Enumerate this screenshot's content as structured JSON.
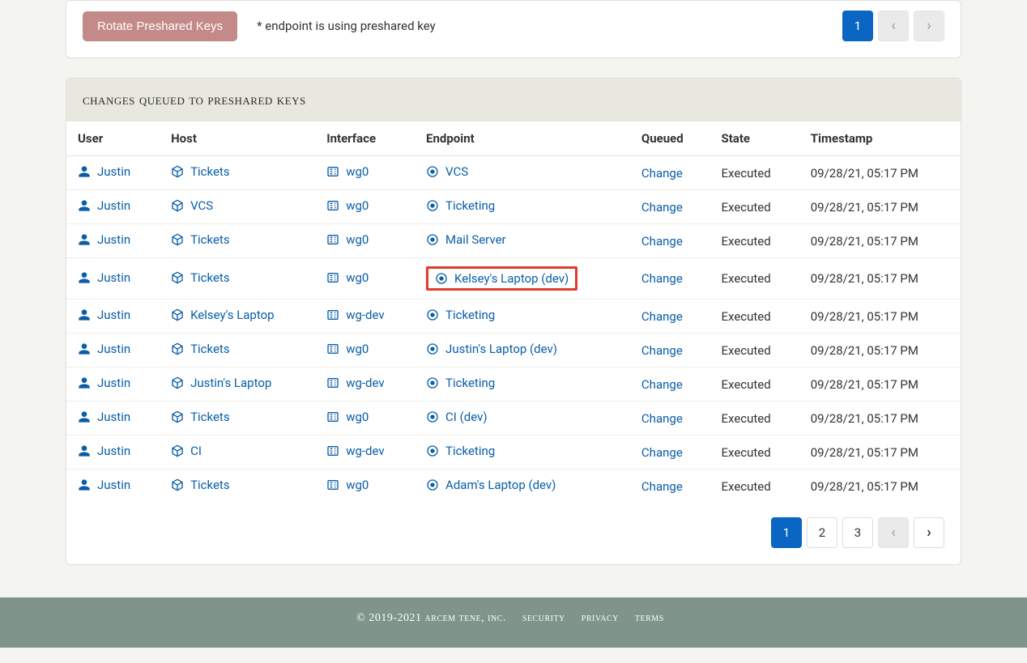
{
  "top": {
    "rotate_label": "Rotate Preshared Keys",
    "note": "* endpoint is using preshared key",
    "page_current": "1"
  },
  "panel": {
    "title": "changes queued to preshared keys"
  },
  "columns": {
    "user": "User",
    "host": "Host",
    "interface": "Interface",
    "endpoint": "Endpoint",
    "queued": "Queued",
    "state": "State",
    "timestamp": "Timestamp"
  },
  "rows": [
    {
      "user": "Justin",
      "host": "Tickets",
      "interface": "wg0",
      "endpoint": "VCS",
      "queued": "Change",
      "state": "Executed",
      "timestamp": "09/28/21, 05:17 PM",
      "hl": false
    },
    {
      "user": "Justin",
      "host": "VCS",
      "interface": "wg0",
      "endpoint": "Ticketing",
      "queued": "Change",
      "state": "Executed",
      "timestamp": "09/28/21, 05:17 PM",
      "hl": false
    },
    {
      "user": "Justin",
      "host": "Tickets",
      "interface": "wg0",
      "endpoint": "Mail Server",
      "queued": "Change",
      "state": "Executed",
      "timestamp": "09/28/21, 05:17 PM",
      "hl": false
    },
    {
      "user": "Justin",
      "host": "Tickets",
      "interface": "wg0",
      "endpoint": "Kelsey's Laptop (dev)",
      "queued": "Change",
      "state": "Executed",
      "timestamp": "09/28/21, 05:17 PM",
      "hl": true
    },
    {
      "user": "Justin",
      "host": "Kelsey's Laptop",
      "interface": "wg-dev",
      "endpoint": "Ticketing",
      "queued": "Change",
      "state": "Executed",
      "timestamp": "09/28/21, 05:17 PM",
      "hl": false
    },
    {
      "user": "Justin",
      "host": "Tickets",
      "interface": "wg0",
      "endpoint": "Justin's Laptop (dev)",
      "queued": "Change",
      "state": "Executed",
      "timestamp": "09/28/21, 05:17 PM",
      "hl": false
    },
    {
      "user": "Justin",
      "host": "Justin's Laptop",
      "interface": "wg-dev",
      "endpoint": "Ticketing",
      "queued": "Change",
      "state": "Executed",
      "timestamp": "09/28/21, 05:17 PM",
      "hl": false
    },
    {
      "user": "Justin",
      "host": "Tickets",
      "interface": "wg0",
      "endpoint": "CI (dev)",
      "queued": "Change",
      "state": "Executed",
      "timestamp": "09/28/21, 05:17 PM",
      "hl": false
    },
    {
      "user": "Justin",
      "host": "CI",
      "interface": "wg-dev",
      "endpoint": "Ticketing",
      "queued": "Change",
      "state": "Executed",
      "timestamp": "09/28/21, 05:17 PM",
      "hl": false
    },
    {
      "user": "Justin",
      "host": "Tickets",
      "interface": "wg0",
      "endpoint": "Adam's Laptop (dev)",
      "queued": "Change",
      "state": "Executed",
      "timestamp": "09/28/21, 05:17 PM",
      "hl": false
    }
  ],
  "pagination": {
    "p1": "1",
    "p2": "2",
    "p3": "3"
  },
  "footer": {
    "copyright": "© 2019-2021 arcem tene, inc.",
    "security": "security",
    "privacy": "privacy",
    "terms": "terms"
  }
}
